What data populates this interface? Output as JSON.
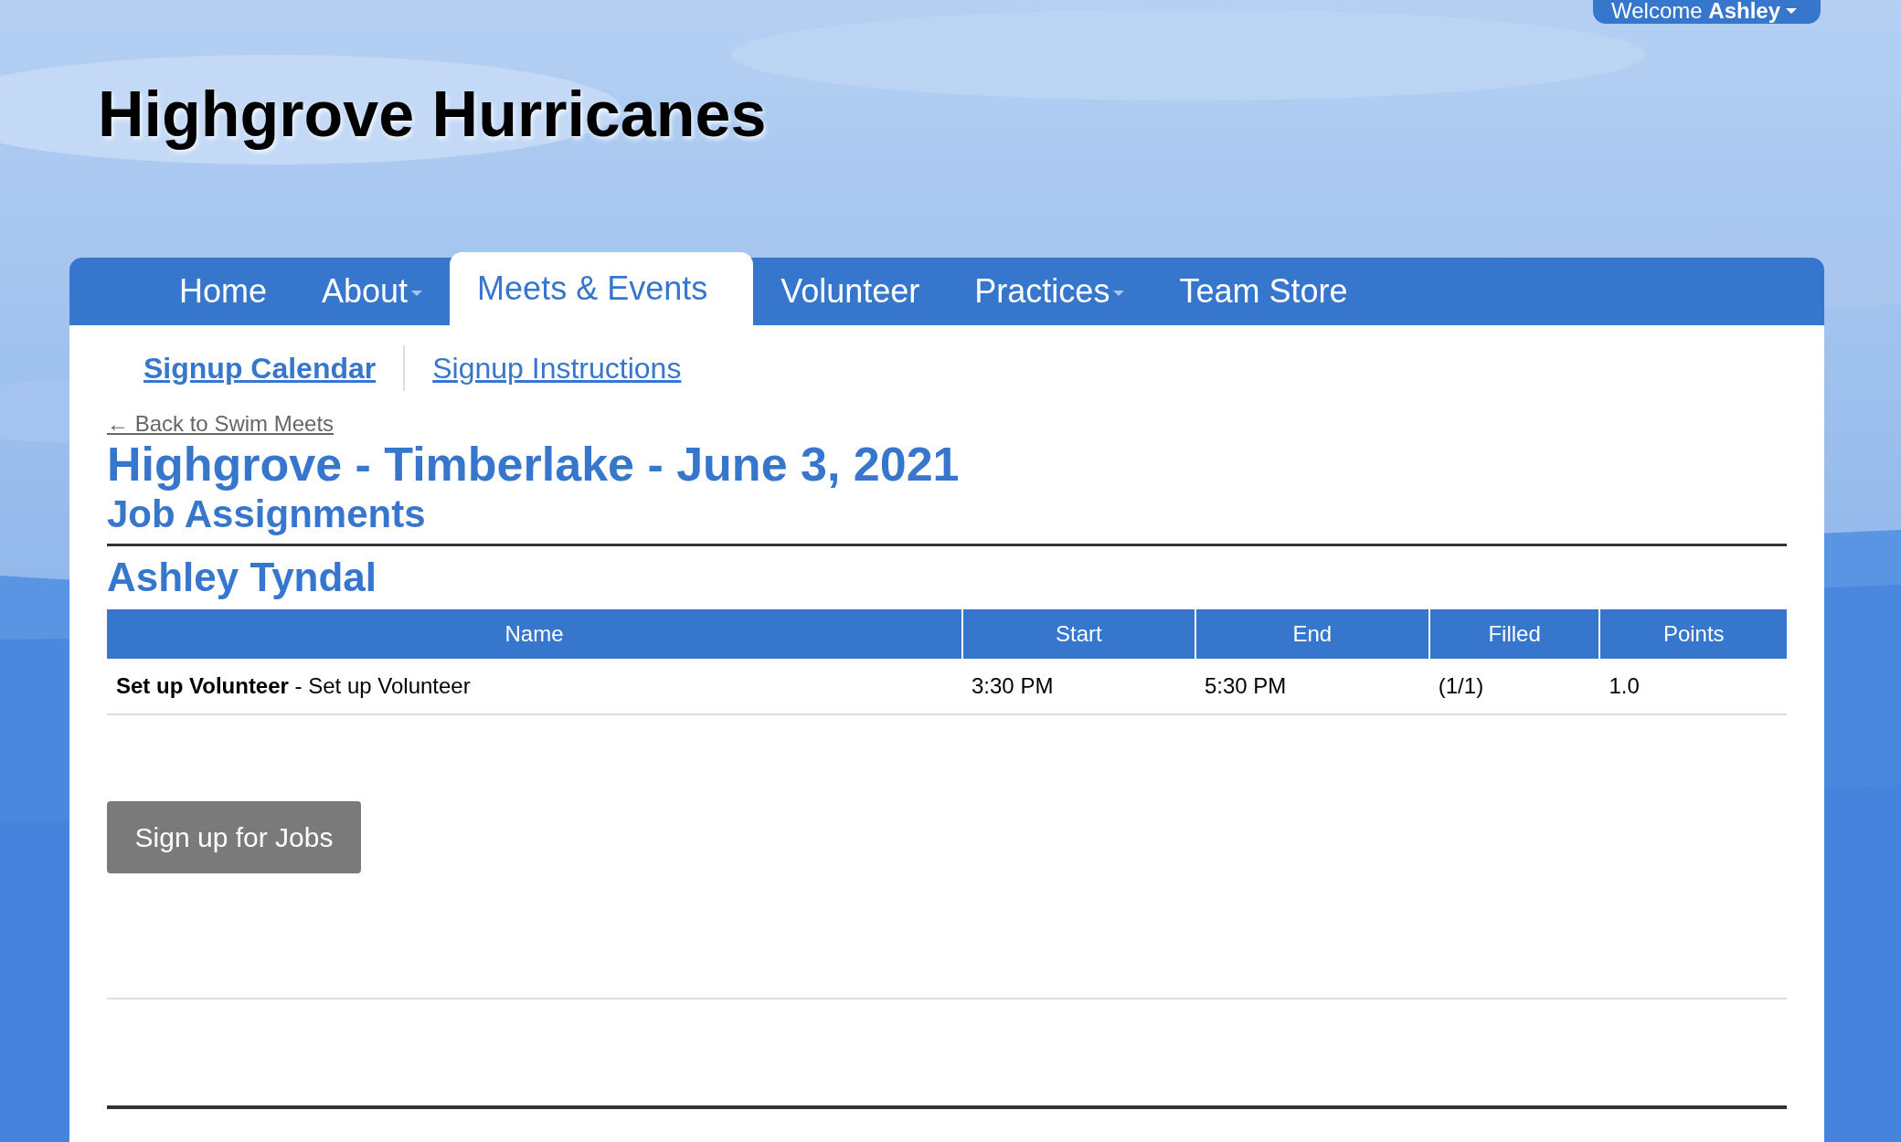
{
  "user_menu": {
    "label": "Welcome **Ashley**"
  },
  "site_title": "Highgrove Hurricanes",
  "nav": [
    {
      "label": "Home",
      "dropdown": false,
      "selected": false
    },
    {
      "label": "About",
      "dropdown": true,
      "selected": false
    },
    {
      "label": "Meets & Events",
      "dropdown": false,
      "selected": true
    },
    {
      "label": "Volunteer",
      "dropdown": false,
      "selected": false
    },
    {
      "label": "Practices",
      "dropdown": true,
      "selected": false
    },
    {
      "label": "Team Store",
      "dropdown": false,
      "selected": false
    }
  ],
  "subnav": [
    {
      "label": "Signup Calendar",
      "selected": true
    },
    {
      "label": "Signup Instructions",
      "selected": false
    }
  ],
  "back_link": "← Back to Swim Meets",
  "event_title": "Highgrove - Timberlake - June 3, 2021",
  "section_title": "Job Assignments",
  "person_name": "Ashley Tyndal",
  "table": {
    "columns": [
      "Name",
      "Start",
      "End",
      "Filled",
      "Points"
    ],
    "rows": [
      {
        "name": "**Set up Volunteer** - Set up Volunteer",
        "start": "3:30 PM",
        "end": "5:30 PM",
        "filled": "(1/1)",
        "points": "1.0"
      }
    ]
  },
  "signup_button": "Sign up for Jobs"
}
